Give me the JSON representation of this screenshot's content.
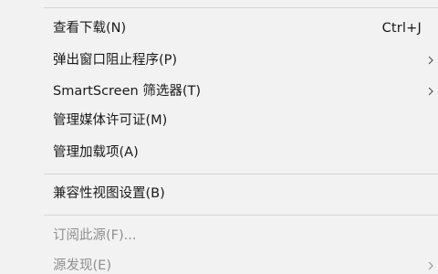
{
  "menu": {
    "items": [
      {
        "label": "查看下载(N)",
        "shortcut": "Ctrl+J"
      },
      {
        "label": "弹出窗口阻止程序(P)"
      },
      {
        "label": "SmartScreen 筛选器(T)"
      },
      {
        "label": "管理媒体许可证(M)"
      },
      {
        "label": "管理加载项(A)"
      },
      {
        "label": "兼容性视图设置(B)"
      },
      {
        "label": "订阅此源(F)..."
      },
      {
        "label": "源发现(E)"
      }
    ]
  }
}
